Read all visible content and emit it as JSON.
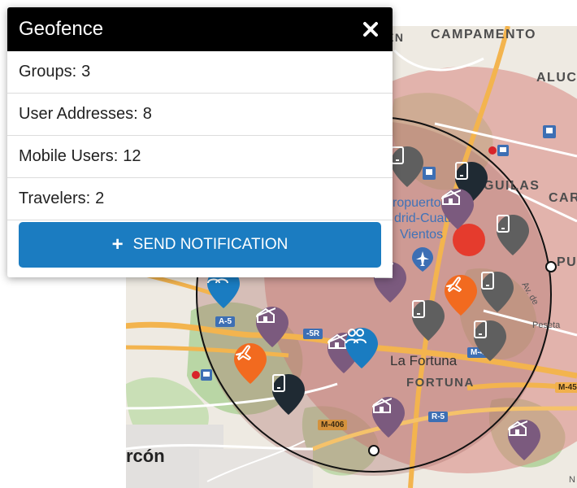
{
  "panel": {
    "title": "Geofence",
    "stats": [
      {
        "label": "Groups:",
        "value": "3"
      },
      {
        "label": "User Addresses:",
        "value": "8"
      },
      {
        "label": "Mobile Users:",
        "value": "12"
      },
      {
        "label": "Travelers:",
        "value": "2"
      }
    ],
    "send_label": "SEND NOTIFICATION",
    "send_icon": "+",
    "close_icon": "close-icon"
  },
  "map": {
    "labels": {
      "campamento": "CAMPAMENTO",
      "aluche": "ALUCH",
      "aguilas": "GUILAS",
      "car": "CAR",
      "pue": "PUE",
      "aeropuerto": "ropuerto",
      "madrid_cuatro": "drid-Cuatro",
      "vientos": "Vientos",
      "la_fortuna": "La Fortuna",
      "fortuna": "FORTUNA",
      "alarcon": "rcón",
      "en": "EN",
      "av": "Av. de",
      "peseta": "Peseta",
      "n": "N"
    },
    "shields": {
      "a5": "A-5",
      "r5_top": "-5R",
      "m406": "M-406",
      "r5": "R-5",
      "m40": "M-4",
      "m45": "M-45"
    },
    "colors": {
      "geofence_fill": "#c9453d",
      "mobile_user": "#5f5f5f",
      "mobile_user_dark": "#1f2a33",
      "address": "#7b5a7e",
      "traveler": "#f26a1f",
      "group": "#1a7cc1",
      "center": "#e53b2d"
    }
  }
}
